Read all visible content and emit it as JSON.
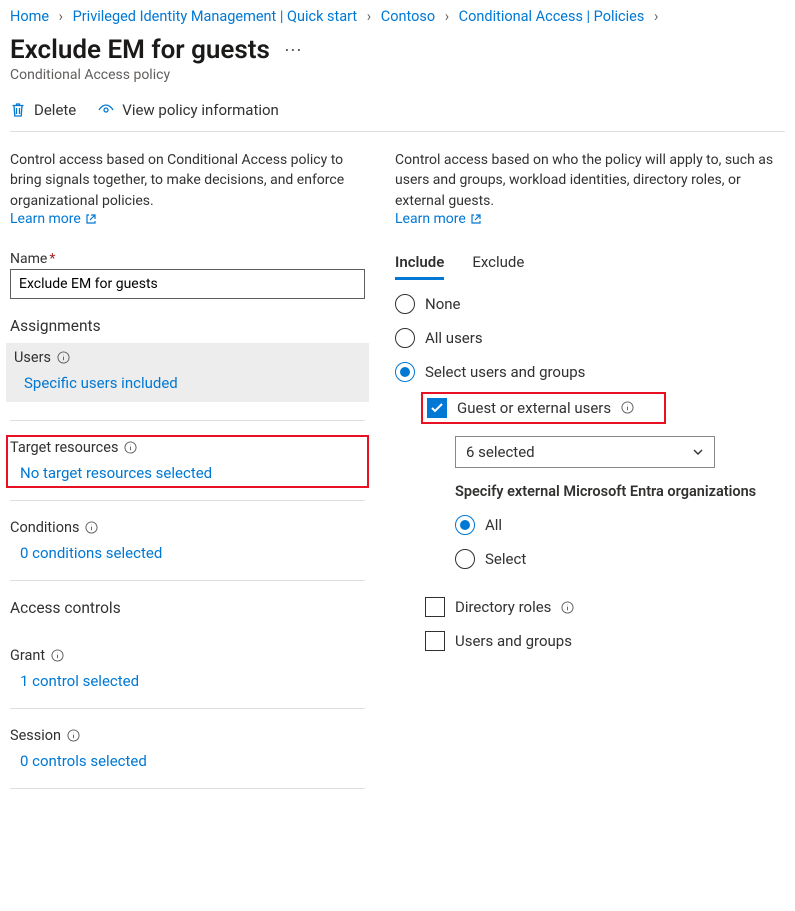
{
  "breadcrumb": [
    "Home",
    "Privileged Identity Management | Quick start",
    "Contoso",
    "Conditional Access | Policies"
  ],
  "title": "Exclude EM for guests",
  "subtitle": "Conditional Access policy",
  "toolbar": {
    "delete": "Delete",
    "view_info": "View policy information"
  },
  "left": {
    "desc": "Control access based on Conditional Access policy to bring signals together, to make decisions, and enforce organizational policies.",
    "learn_more": "Learn more",
    "name_label": "Name",
    "name_value": "Exclude EM for guests",
    "assignments_header": "Assignments",
    "users": {
      "label": "Users",
      "value": "Specific users included"
    },
    "target": {
      "label": "Target resources",
      "value": "No target resources selected"
    },
    "conditions": {
      "label": "Conditions",
      "value": "0 conditions selected"
    },
    "access_header": "Access controls",
    "grant": {
      "label": "Grant",
      "value": "1 control selected"
    },
    "session": {
      "label": "Session",
      "value": "0 controls selected"
    }
  },
  "right": {
    "desc": "Control access based on who the policy will apply to, such as users and groups, workload identities, directory roles, or external guests.",
    "learn_more": "Learn more",
    "tabs": {
      "include": "Include",
      "exclude": "Exclude"
    },
    "options": {
      "none": "None",
      "all_users": "All users",
      "select_ug": "Select users and groups",
      "guest_ext": "Guest or external users",
      "dropdown_value": "6 selected",
      "specify_org_header": "Specify external Microsoft Entra organizations",
      "org_all": "All",
      "org_select": "Select",
      "dir_roles": "Directory roles",
      "users_groups": "Users and groups"
    }
  }
}
